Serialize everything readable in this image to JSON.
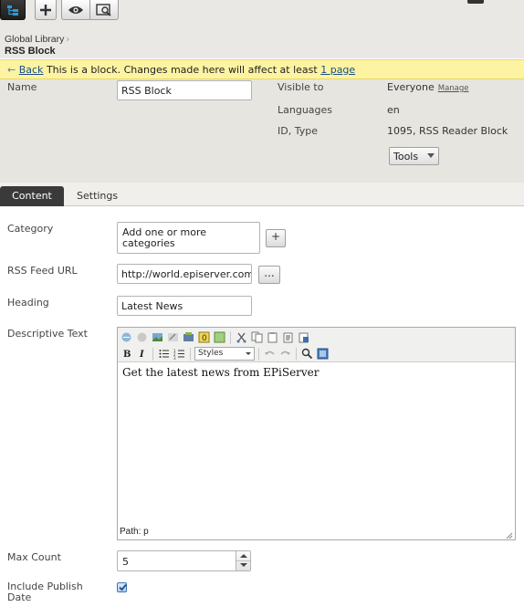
{
  "toolbar": {
    "icons": [
      "tree-icon",
      "add-icon",
      "preview-icon",
      "compare-icon"
    ]
  },
  "breadcrumb": {
    "parent": "Global Library",
    "separator": "›",
    "current": "RSS Block"
  },
  "notice": {
    "back_arrow": "←",
    "back_label": "Back",
    "message": "This is a block. Changes made here will affect at least",
    "link_label": "1 page"
  },
  "properties": {
    "name_label": "Name",
    "name_value": "RSS Block",
    "visible_to_label": "Visible to",
    "visible_to_value": "Everyone",
    "manage_label": "Manage",
    "languages_label": "Languages",
    "languages_value": "en",
    "id_type_label": "ID, Type",
    "id_type_value": "1095, RSS Reader Block",
    "tools_label": "Tools"
  },
  "tabs": [
    {
      "label": "Content",
      "active": true
    },
    {
      "label": "Settings",
      "active": false
    }
  ],
  "form": {
    "category_label": "Category",
    "category_value": "Add one or more categories",
    "category_add_button": "+",
    "rss_label": "RSS Feed URL",
    "rss_value": "http://world.episerver.com",
    "rss_browse_button": "...",
    "heading_label": "Heading",
    "heading_value": "Latest News",
    "descriptive_label": "Descriptive Text",
    "editor_styles_label": "Styles",
    "editor_body": "Get the latest news from EPiServer",
    "editor_path": "Path: p",
    "max_count_label": "Max Count",
    "max_count_value": "5",
    "include_publish_label": "Include Publish Date",
    "include_publish_checked": true
  },
  "colors": {
    "notice_bg": "#fcf4a3",
    "panel_bg": "#e6e5df",
    "active_tab_bg": "#3a3a3a",
    "link": "#1c4e86",
    "checkbox": "#3b74b5"
  }
}
